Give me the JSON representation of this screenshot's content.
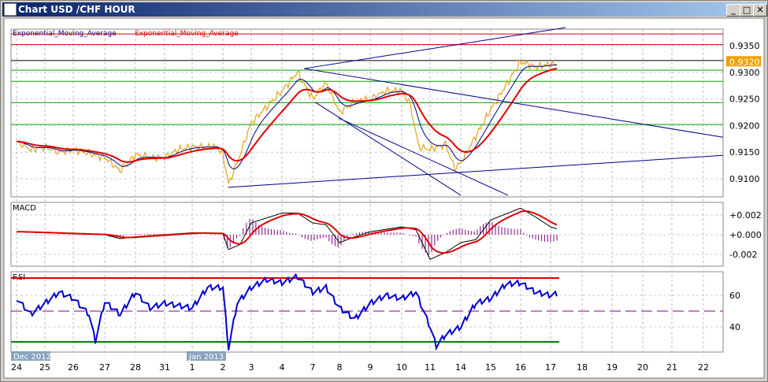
{
  "window": {
    "title": "Chart USD /CHF  HOUR",
    "minimize": "_",
    "maximize": "□",
    "close": "✕"
  },
  "legend": {
    "ema_fast": "Exponential_Moving_Average",
    "ema_slow": "Exponential_Moving_Average"
  },
  "macd_label": "MACD",
  "rsi_label": "RSI",
  "colors": {
    "price": "#e8a317",
    "ema_fast": "#000080",
    "ema_slow": "#e00000",
    "trend": "#00008b",
    "macd": "#000000",
    "signal": "#e00000",
    "hist": "#800080",
    "rsi": "#0000cc",
    "rsi_low": "#00dd00"
  },
  "chart_data": {
    "type": "line",
    "x_labels": [
      "24",
      "25",
      "26",
      "27",
      "28",
      "31",
      "1",
      "2",
      "3",
      "4",
      "7",
      "8",
      "9",
      "10",
      "11",
      "14",
      "15",
      "16",
      "17",
      "18",
      "19",
      "20",
      "21",
      "22"
    ],
    "month_labels": [
      {
        "at": 0,
        "text": "Dec 2012"
      },
      {
        "at": 6,
        "text": "Jan 2013"
      }
    ],
    "price": {
      "ticks": [
        "0.9350",
        "0.9300",
        "0.9250",
        "0.9200",
        "0.9150",
        "0.9100"
      ],
      "current": "0.9320",
      "current_value": 0.932,
      "series": [
        [
          0,
          0.917
        ],
        [
          0.5,
          0.9155
        ],
        [
          1,
          0.916
        ],
        [
          1.5,
          0.915
        ],
        [
          2,
          0.9155
        ],
        [
          3,
          0.914
        ],
        [
          3.5,
          0.9115
        ],
        [
          4,
          0.9145
        ],
        [
          4.5,
          0.914
        ],
        [
          5,
          0.914
        ],
        [
          5.5,
          0.9155
        ],
        [
          6,
          0.916
        ],
        [
          6.8,
          0.916
        ],
        [
          7,
          0.9145
        ],
        [
          7.2,
          0.909
        ],
        [
          7.5,
          0.913
        ],
        [
          8,
          0.9205
        ],
        [
          8.5,
          0.9235
        ],
        [
          9,
          0.9265
        ],
        [
          9.5,
          0.93
        ],
        [
          9.8,
          0.927
        ],
        [
          10,
          0.925
        ],
        [
          10.5,
          0.928
        ],
        [
          11,
          0.9225
        ],
        [
          11.5,
          0.9245
        ],
        [
          12,
          0.925
        ],
        [
          12.5,
          0.9265
        ],
        [
          13,
          0.9265
        ],
        [
          13.3,
          0.924
        ],
        [
          13.6,
          0.916
        ],
        [
          14,
          0.9155
        ],
        [
          14.5,
          0.9165
        ],
        [
          14.8,
          0.912
        ],
        [
          15,
          0.913
        ],
        [
          15.5,
          0.918
        ],
        [
          16,
          0.923
        ],
        [
          16.5,
          0.9275
        ],
        [
          17,
          0.932
        ],
        [
          17.5,
          0.931
        ],
        [
          18,
          0.9315
        ],
        [
          18.2,
          0.9315
        ]
      ],
      "hlines": [
        {
          "v": 0.9372,
          "c": "#d00000"
        },
        {
          "v": 0.9352,
          "c": "#d00000"
        },
        {
          "v": 0.9322,
          "c": "#000000"
        },
        {
          "v": 0.9304,
          "c": "#00aa00"
        },
        {
          "v": 0.9283,
          "c": "#00aa00"
        },
        {
          "v": 0.9243,
          "c": "#00aa00"
        },
        {
          "v": 0.9202,
          "c": "#00aa00"
        }
      ],
      "trendlines": [
        [
          [
            9.72,
            0.9307
          ],
          [
            18.48,
            0.9384
          ]
        ],
        [
          [
            9.72,
            0.9307
          ],
          [
            23.64,
            0.9178
          ]
        ],
        [
          [
            7.18,
            0.9084
          ],
          [
            23.64,
            0.9144
          ]
        ],
        [
          [
            10.09,
            0.9244
          ],
          [
            15,
            0.9069
          ]
        ],
        [
          [
            10.97,
            0.9214
          ],
          [
            16.58,
            0.9069
          ]
        ]
      ]
    },
    "macd": {
      "ticks": [
        "+0.002",
        "+0.000",
        "-0.002"
      ],
      "series": [
        [
          0,
          0.0003
        ],
        [
          2,
          0.0001
        ],
        [
          3,
          0
        ],
        [
          3.5,
          -0.0004
        ],
        [
          4,
          -0.0002
        ],
        [
          5,
          0
        ],
        [
          6,
          0.0002
        ],
        [
          7,
          0.0001
        ],
        [
          7.2,
          -0.0015
        ],
        [
          7.6,
          -0.001
        ],
        [
          8,
          0.0012
        ],
        [
          9,
          0.0022
        ],
        [
          9.5,
          0.0022
        ],
        [
          10,
          0.0012
        ],
        [
          10.5,
          0.001
        ],
        [
          11,
          -0.0008
        ],
        [
          11.5,
          -0.0002
        ],
        [
          12,
          0.0003
        ],
        [
          13,
          0.0008
        ],
        [
          13.5,
          0.0005
        ],
        [
          14,
          -0.0025
        ],
        [
          14.5,
          -0.0018
        ],
        [
          15,
          -0.0008
        ],
        [
          15.5,
          -0.0005
        ],
        [
          16,
          0.0015
        ],
        [
          17,
          0.0027
        ],
        [
          17.5,
          0.0018
        ],
        [
          18,
          0.0008
        ],
        [
          18.2,
          0.0006
        ]
      ]
    },
    "rsi": {
      "ticks": [
        "60",
        "40"
      ],
      "upper": 71,
      "lower": 30.5,
      "mid": 50,
      "series": [
        [
          0,
          58
        ],
        [
          0.5,
          48
        ],
        [
          1,
          55
        ],
        [
          1.5,
          62
        ],
        [
          2,
          58
        ],
        [
          2.5,
          48
        ],
        [
          2.7,
          31
        ],
        [
          3,
          56
        ],
        [
          3.5,
          48
        ],
        [
          4,
          62
        ],
        [
          4.5,
          52
        ],
        [
          5,
          55
        ],
        [
          6,
          52
        ],
        [
          6.5,
          65
        ],
        [
          7,
          65
        ],
        [
          7.2,
          26
        ],
        [
          7.5,
          55
        ],
        [
          8,
          65
        ],
        [
          8.5,
          70
        ],
        [
          9,
          68
        ],
        [
          9.5,
          72
        ],
        [
          10,
          62
        ],
        [
          10.5,
          65
        ],
        [
          11,
          52
        ],
        [
          11.5,
          45
        ],
        [
          12,
          55
        ],
        [
          12.5,
          60
        ],
        [
          13,
          58
        ],
        [
          13.5,
          62
        ],
        [
          14,
          40
        ],
        [
          14.2,
          28
        ],
        [
          14.5,
          35
        ],
        [
          15,
          40
        ],
        [
          15.5,
          55
        ],
        [
          16,
          58
        ],
        [
          16.5,
          67
        ],
        [
          17,
          68
        ],
        [
          17.5,
          62
        ],
        [
          18,
          60
        ],
        [
          18.2,
          61
        ]
      ]
    }
  }
}
